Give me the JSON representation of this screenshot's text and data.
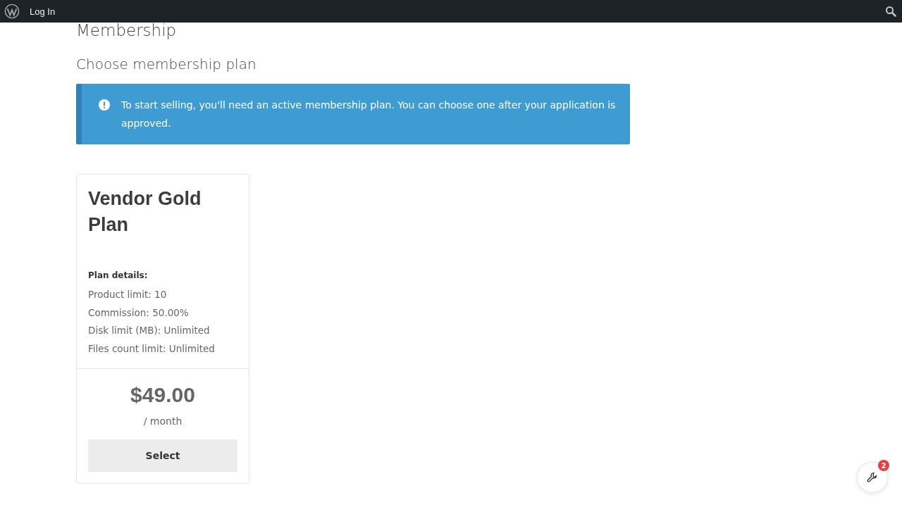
{
  "admin_bar": {
    "login": "Log In"
  },
  "page_title": "Membership",
  "section_title": "Choose membership plan",
  "notice": {
    "text": "To start selling, you'll need an active membership plan. You can choose one after your application is approved."
  },
  "plans": [
    {
      "name": "Vendor Gold Plan",
      "details_heading": "Plan details:",
      "details": [
        "Product limit: 10",
        "Commission: 50.00%",
        "Disk limit (MB): Unlimited",
        "Files count limit: Unlimited"
      ],
      "price": "$49.00",
      "period": "/ month",
      "button": "Select"
    }
  ],
  "help_button": {
    "badge": "2"
  }
}
